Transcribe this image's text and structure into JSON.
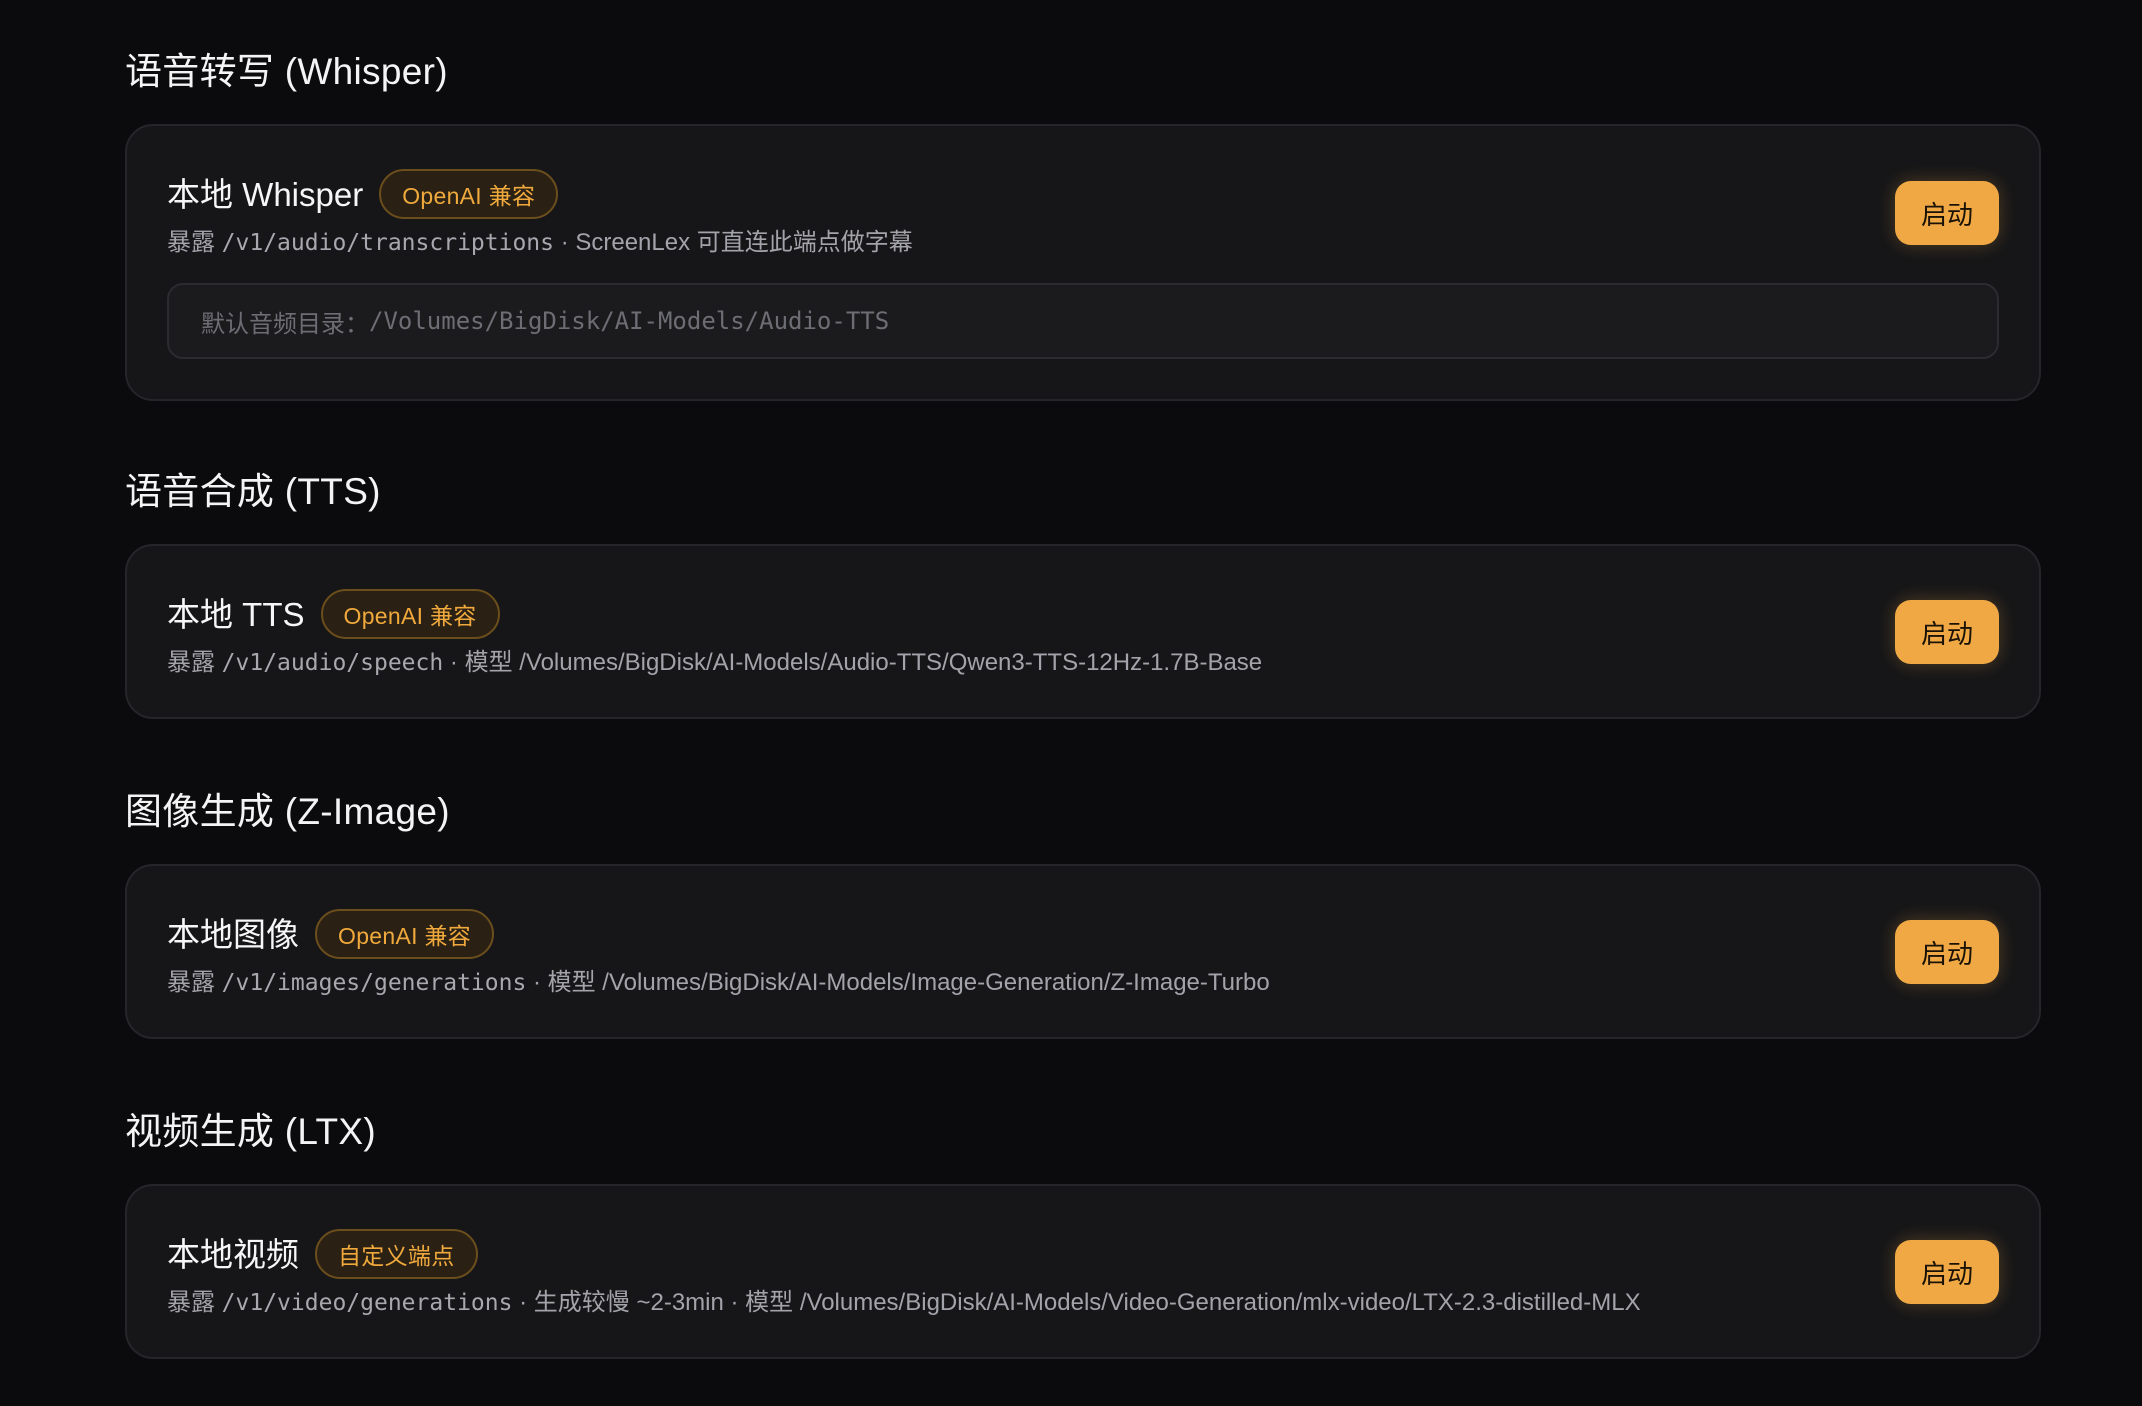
{
  "sections": [
    {
      "title": "语音转写 (Whisper)",
      "card": {
        "name": "本地 Whisper",
        "badge": "OpenAI 兼容",
        "desc_prefix": "暴露",
        "endpoint": "/v1/audio/transcriptions",
        "desc_suffix": "· ScreenLex 可直连此端点做字幕",
        "field_label": "默认音频目录：",
        "field_value": "/Volumes/BigDisk/AI-Models/Audio-TTS",
        "button": "启动"
      }
    },
    {
      "title": "语音合成 (TTS)",
      "card": {
        "name": "本地 TTS",
        "badge": "OpenAI 兼容",
        "desc_prefix": "暴露",
        "endpoint": "/v1/audio/speech",
        "desc_suffix": "· 模型 /Volumes/BigDisk/AI-Models/Audio-TTS/Qwen3-TTS-12Hz-1.7B-Base",
        "button": "启动"
      }
    },
    {
      "title": "图像生成 (Z-Image)",
      "card": {
        "name": "本地图像",
        "badge": "OpenAI 兼容",
        "desc_prefix": "暴露",
        "endpoint": "/v1/images/generations",
        "desc_suffix": "· 模型 /Volumes/BigDisk/AI-Models/Image-Generation/Z-Image-Turbo",
        "button": "启动"
      }
    },
    {
      "title": "视频生成 (LTX)",
      "card": {
        "name": "本地视频",
        "badge": "自定义端点",
        "desc_prefix": "暴露",
        "endpoint": "/v1/video/generations",
        "desc_suffix": "· 生成较慢 ~2-3min · 模型 /Volumes/BigDisk/AI-Models/Video-Generation/mlx-video/LTX-2.3-distilled-MLX",
        "button": "启动"
      }
    }
  ],
  "colors": {
    "background": "#0b0b0d",
    "card": "#161618",
    "accent": "#efa843",
    "badge_text": "#f0a93c"
  }
}
